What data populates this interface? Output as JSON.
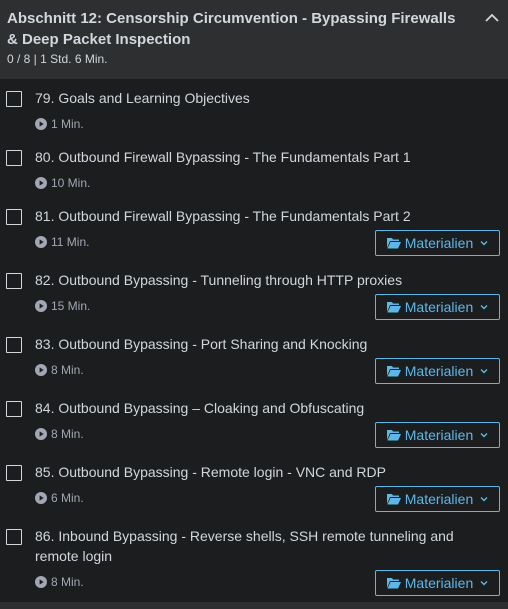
{
  "section": {
    "title": "Abschnitt 12: Censorship Circumvention - Bypassing Firewalls & Deep Packet Inspection",
    "meta": "0 / 8 | 1 Std. 6 Min."
  },
  "resource_label": "Materialien",
  "lectures": [
    {
      "title": "79. Goals and Learning Objectives",
      "duration": "1 Min."
    },
    {
      "title": "80. Outbound Firewall Bypassing - The Fundamentals Part 1",
      "duration": "10 Min."
    },
    {
      "title": "81. Outbound Firewall Bypassing - The Fundamentals Part 2",
      "duration": "11 Min."
    },
    {
      "title": "82. Outbound Bypassing - Tunneling through HTTP proxies",
      "duration": "15 Min."
    },
    {
      "title": "83. Outbound Bypassing - Port Sharing and Knocking",
      "duration": "8 Min."
    },
    {
      "title": "84. Outbound Bypassing – Cloaking and Obfuscating",
      "duration": "8 Min."
    },
    {
      "title": "85. Outbound Bypassing - Remote login - VNC and RDP",
      "duration": "6 Min."
    },
    {
      "title": "86. Inbound Bypassing - Reverse shells, SSH remote tunneling and remote login",
      "duration": "8 Min."
    }
  ],
  "colors": {
    "background": "#1c1d1f",
    "header_background": "#2d2f31",
    "text": "#d1d7dc",
    "muted": "#a1a7b3",
    "accent": "#5db8e8"
  }
}
